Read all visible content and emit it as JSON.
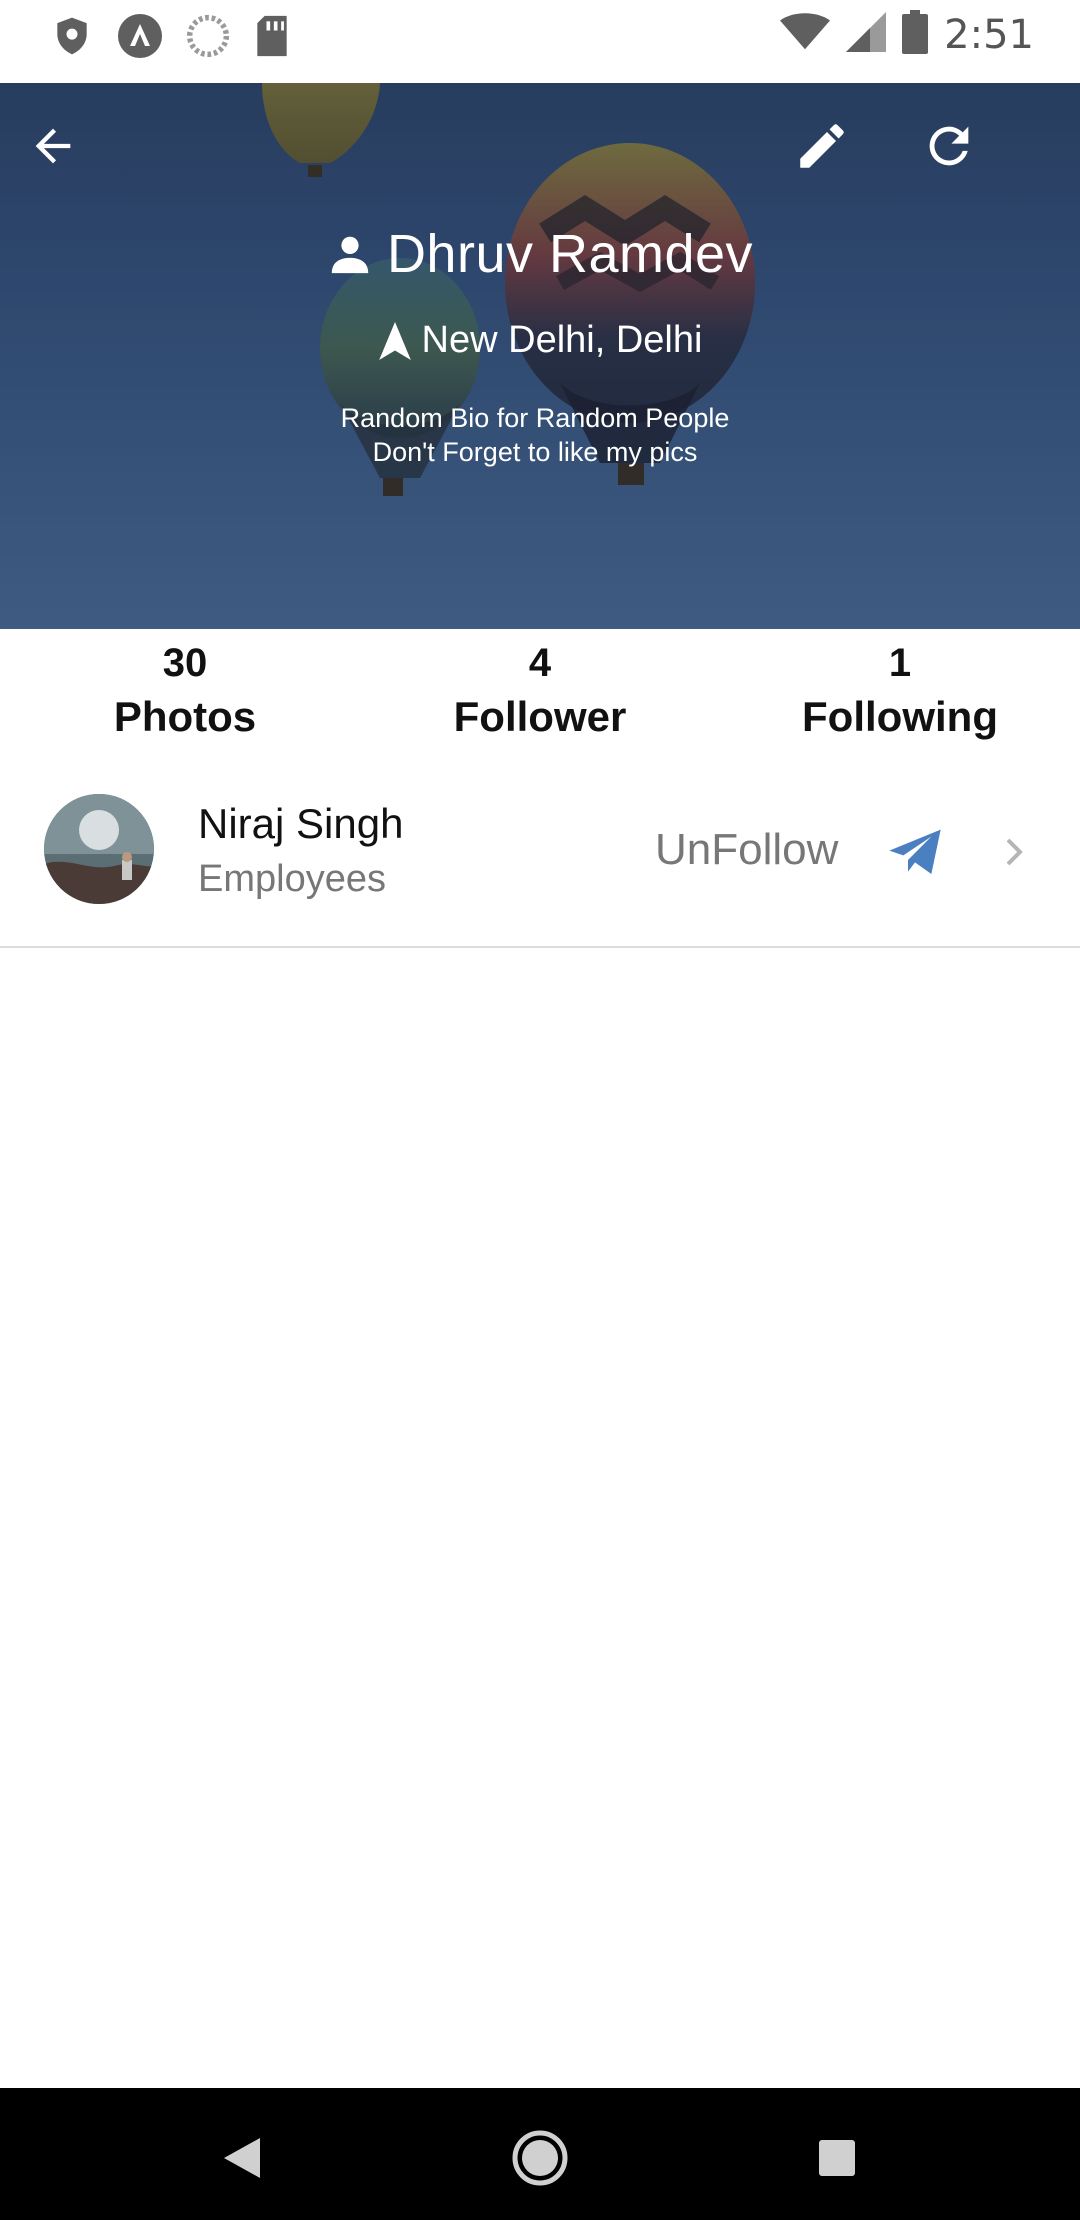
{
  "status_bar": {
    "time": "2:51",
    "left_icons": [
      "shield-icon",
      "app-a-icon",
      "sync-circle-icon",
      "sd-card-icon"
    ],
    "right_icons": [
      "wifi-icon",
      "cell-signal-icon",
      "battery-icon"
    ]
  },
  "header": {
    "back_icon": "arrow-left-icon",
    "edit_icon": "pencil-icon",
    "refresh_icon": "refresh-icon",
    "name": "Dhruv Ramdev",
    "location": "New Delhi, Delhi",
    "bio_line1": "Random Bio for Random People",
    "bio_line2": "Don't Forget to like my pics"
  },
  "stats": {
    "photos_count": "30",
    "photos_label": "Photos",
    "followers_count": "4",
    "followers_label": "Follower",
    "following_count": "1",
    "following_label": "Following"
  },
  "following_list": [
    {
      "name": "Niraj Singh",
      "subtitle": "Employees",
      "action_label": "UnFollow",
      "send_icon": "paper-plane-icon",
      "chevron_icon": "chevron-right-icon"
    }
  ],
  "nav_bar": {
    "icons": [
      "nav-back-icon",
      "nav-home-icon",
      "nav-recents-icon"
    ]
  },
  "colors": {
    "accent_send": "#4a7fc0",
    "text_dark": "#111111",
    "text_muted": "#777777",
    "header_sky": "#34507a"
  }
}
